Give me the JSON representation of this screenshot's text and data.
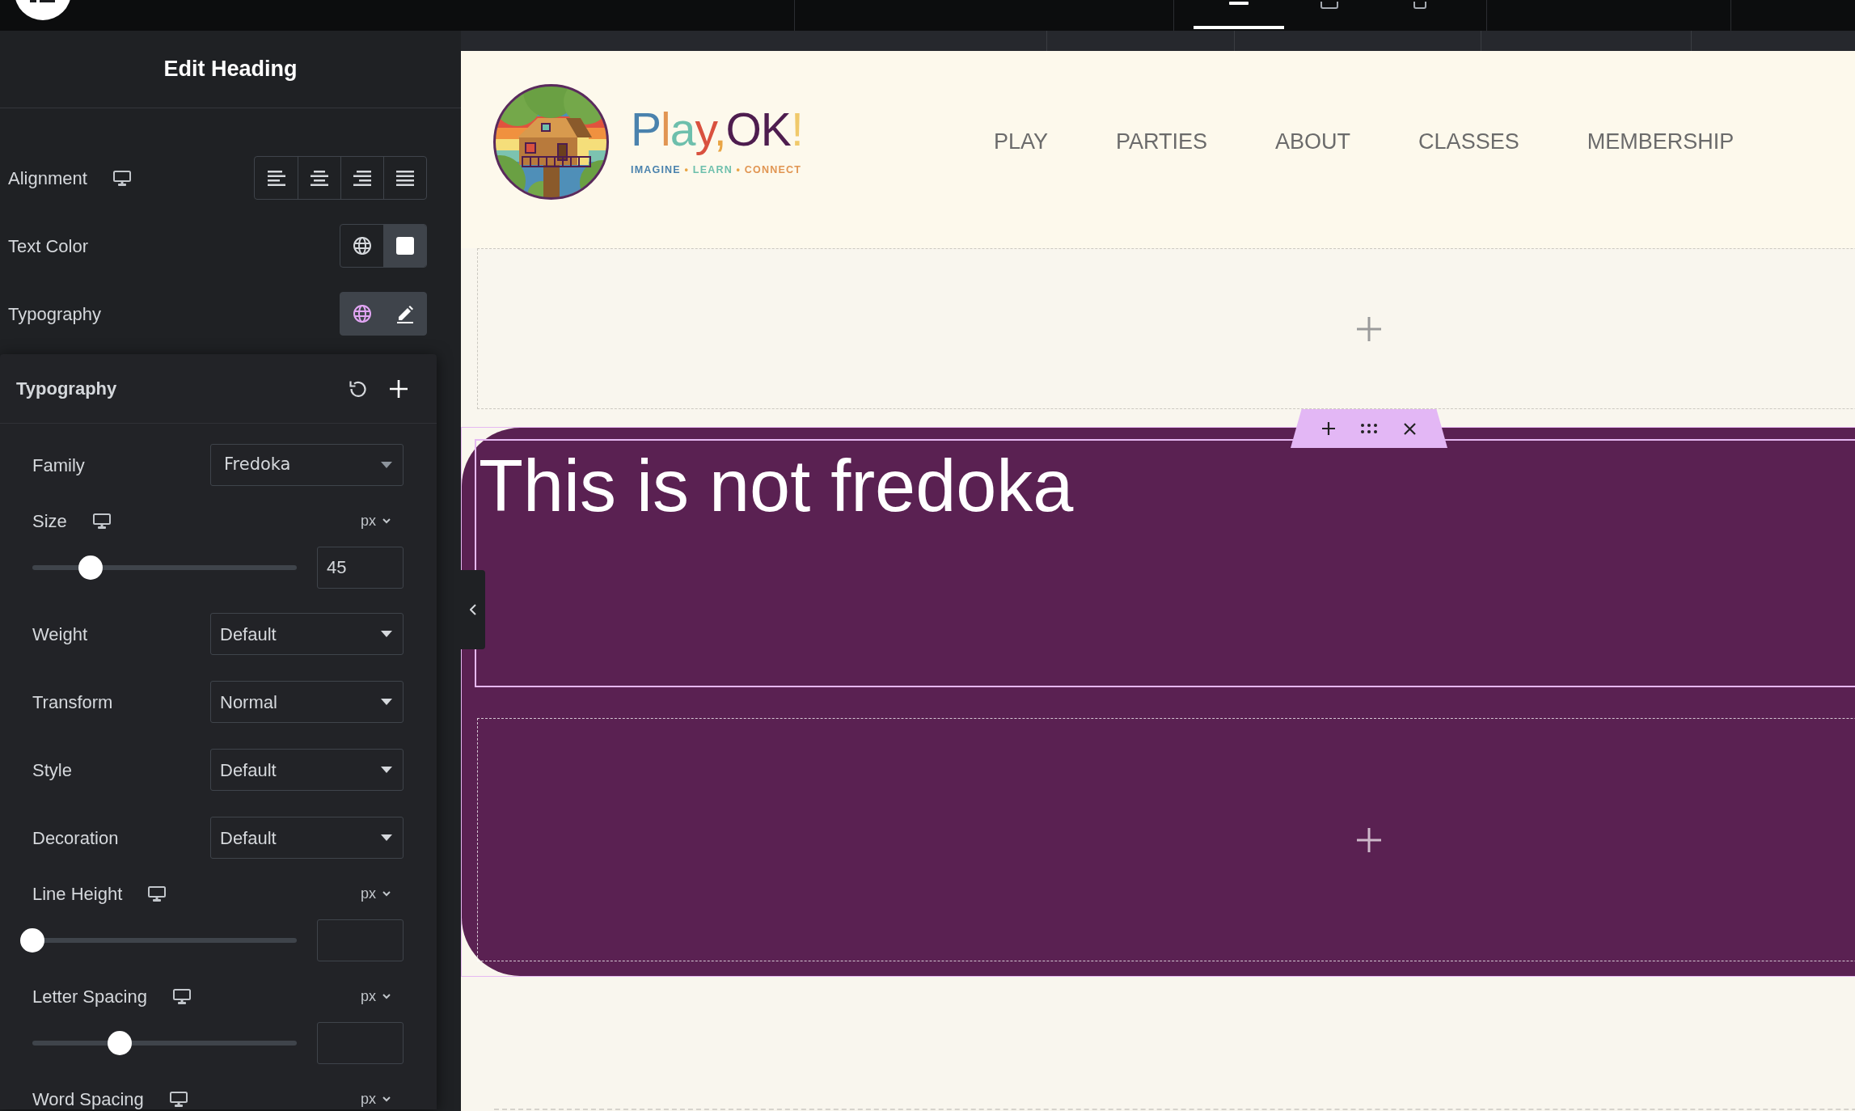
{
  "top_bar": {
    "device_tabs": [
      {
        "kind": "desktop",
        "selected": true
      },
      {
        "kind": "tablet",
        "selected": false
      },
      {
        "kind": "mobile",
        "selected": false
      }
    ]
  },
  "panel": {
    "title": "Edit Heading",
    "controls": [
      {
        "kind": "choose",
        "label": "Alignment",
        "responsive": true,
        "options": [
          {
            "kind": "left",
            "selected": false
          },
          {
            "kind": "center",
            "selected": false
          },
          {
            "kind": "right",
            "selected": false
          },
          {
            "kind": "justify",
            "selected": false
          }
        ]
      },
      {
        "kind": "color",
        "label": "Text Color",
        "global_linked": false,
        "color": "#ffffff"
      },
      {
        "kind": "typography",
        "label": "Typography",
        "global_linked": true,
        "expanded": true,
        "popover": {
          "title": "Typography",
          "fields": [
            {
              "kind": "font_select",
              "label": "Family",
              "value": "Fredoka"
            },
            {
              "kind": "slider",
              "label": "Size",
              "responsive": true,
              "unit": "px",
              "level": 0.22,
              "value": "45"
            },
            {
              "kind": "select",
              "label": "Weight",
              "value": "Default"
            },
            {
              "kind": "select",
              "label": "Transform",
              "value": "Normal"
            },
            {
              "kind": "select",
              "label": "Style",
              "value": "Default"
            },
            {
              "kind": "select",
              "label": "Decoration",
              "value": "Default"
            },
            {
              "kind": "slider",
              "label": "Line Height",
              "responsive": true,
              "unit": "px",
              "level": 0
            },
            {
              "kind": "slider",
              "label": "Letter Spacing",
              "responsive": true,
              "unit": "px",
              "level": 0.33
            },
            {
              "kind": "label_row",
              "label": "Word Spacing",
              "responsive": true,
              "unit": "px"
            }
          ]
        }
      }
    ]
  },
  "canvas": {
    "site_header": {
      "brand": {
        "name": [
          {
            "text": "P",
            "color": "#4a82ad"
          },
          {
            "text": "l",
            "color": "#e19552"
          },
          {
            "text": "a",
            "color": "#6dbfac"
          },
          {
            "text": "y",
            "color": "#d9513f"
          },
          {
            "text": ",",
            "color": "#e9a545"
          },
          {
            "text": "OK",
            "color": "#4e1d4f"
          },
          {
            "text": "!",
            "color": "#f0c96a"
          }
        ],
        "tagline": [
          {
            "text": "IMAGINE",
            "color": "#4a82ad"
          },
          {
            "text": " • ",
            "color": "#e9a545"
          },
          {
            "text": "LEARN",
            "color": "#6dbfac"
          },
          {
            "text": " • ",
            "color": "#e9a545"
          },
          {
            "text": "CONNECT",
            "color": "#e19552"
          }
        ]
      },
      "menu": [
        {
          "label": "PLAY"
        },
        {
          "label": "PARTIES"
        },
        {
          "label": "ABOUT"
        },
        {
          "label": "CLASSES"
        },
        {
          "label": "MEMBERSHIP"
        }
      ]
    },
    "sections": [
      {
        "kind": "drop_zone"
      },
      {
        "kind": "container",
        "selected": true,
        "children": [
          {
            "kind": "heading",
            "text": "This is not fredoka",
            "selected": true
          },
          {
            "kind": "drop_zone"
          }
        ]
      }
    ]
  }
}
